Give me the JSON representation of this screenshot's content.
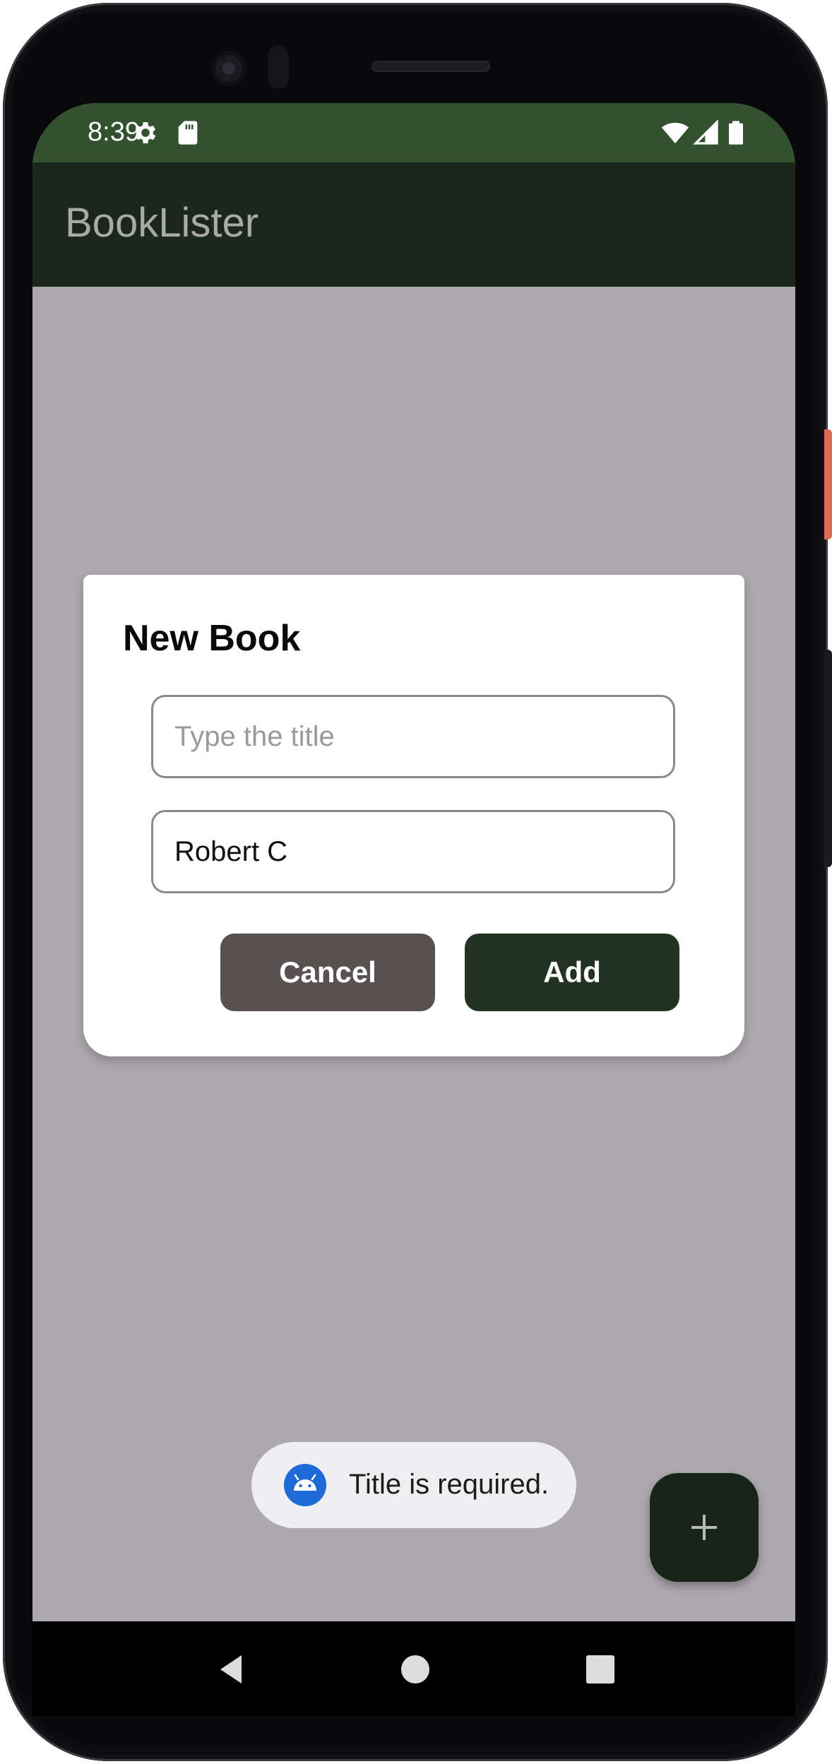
{
  "status_bar": {
    "time": "8:39",
    "icons_left": [
      "gear-icon",
      "sd-card-icon"
    ],
    "icons_right": [
      "wifi-icon",
      "signal-icon",
      "battery-icon"
    ],
    "background_color": "#31512f"
  },
  "app_bar": {
    "title": "BookLister",
    "background_color": "#1b271b"
  },
  "dialog": {
    "title": "New Book",
    "title_field": {
      "value": "",
      "placeholder": "Type the title"
    },
    "author_field": {
      "value": "Robert C",
      "placeholder": ""
    },
    "cancel_label": "Cancel",
    "add_label": "Add",
    "cancel_color": "#585051",
    "add_color": "#223322"
  },
  "toast": {
    "icon": "android-icon",
    "message": "Title is required."
  },
  "fab": {
    "icon": "plus-icon",
    "color": "#182418"
  },
  "nav_bar": {
    "items": [
      "back-icon",
      "home-icon",
      "recents-icon"
    ]
  }
}
